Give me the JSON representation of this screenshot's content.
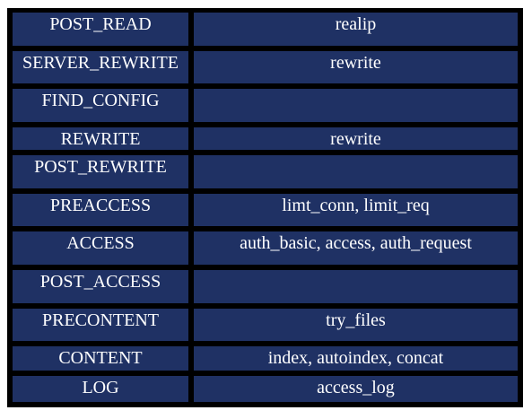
{
  "rows": [
    {
      "phase": "POST_READ",
      "modules": "realip"
    },
    {
      "phase": "SERVER_REWRITE",
      "modules": "rewrite"
    },
    {
      "phase": "FIND_CONFIG",
      "modules": ""
    },
    {
      "phase": "REWRITE",
      "modules": "rewrite"
    },
    {
      "phase": "POST_REWRITE",
      "modules": ""
    },
    {
      "phase": "PREACCESS",
      "modules": "limt_conn, limit_req"
    },
    {
      "phase": "ACCESS",
      "modules": "auth_basic, access, auth_request"
    },
    {
      "phase": "POST_ACCESS",
      "modules": ""
    },
    {
      "phase": "PRECONTENT",
      "modules": "try_files"
    },
    {
      "phase": "CONTENT",
      "modules": "index, autoindex, concat"
    },
    {
      "phase": "LOG",
      "modules": "access_log"
    }
  ],
  "colors": {
    "cell_background": "#1f3164",
    "grid_lines": "#000000",
    "text": "#ffffff"
  }
}
